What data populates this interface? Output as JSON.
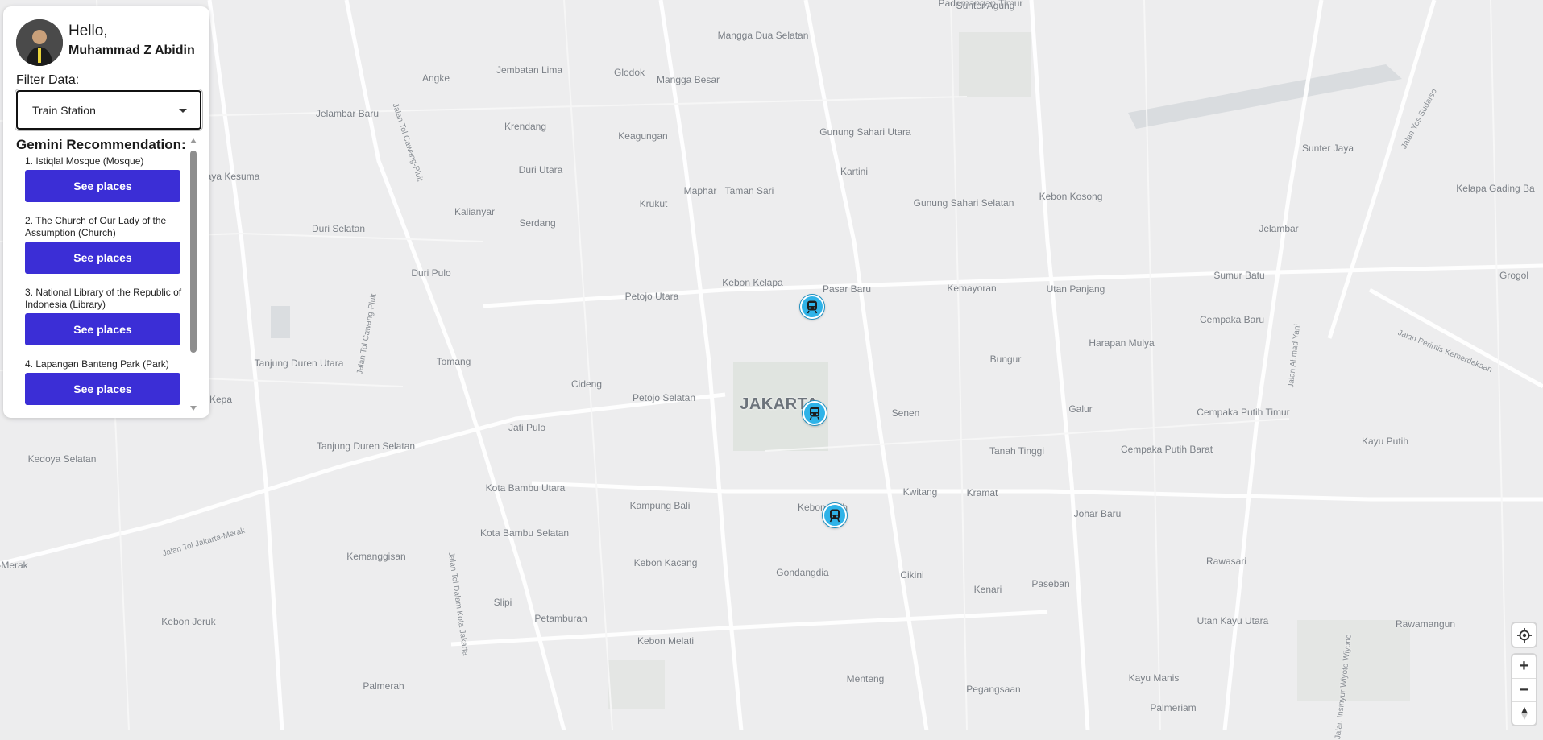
{
  "user": {
    "greeting": "Hello,",
    "name": "Muhammad Z Abidin"
  },
  "filter": {
    "label": "Filter Data:",
    "selected": "Train Station"
  },
  "recommendation": {
    "title": "Gemini Recommendation:",
    "items": [
      {
        "name": "1. Istiqlal Mosque (Mosque)",
        "button": "See places"
      },
      {
        "name": "2. The Church of Our Lady of the Assumption (Church)",
        "button": "See places"
      },
      {
        "name": "3. National Library of the Republic of Indonesia (Library)",
        "button": "See places"
      },
      {
        "name": "4. Lapangan Banteng Park (Park)",
        "button": "See places"
      }
    ]
  },
  "map": {
    "city": "JAKARTA",
    "labels": [
      "Pademangan Timur",
      "Sunter Agung",
      "Mangga Dua Selatan",
      "Angke",
      "Jembatan Lima",
      "Glodok",
      "Mangga Besar",
      "Jelambar Baru",
      "Krendang",
      "Keagungan",
      "Gunung Sahari Utara",
      "Sunter Jaya",
      "Kelapa Gading Ba",
      "aya Kesuma",
      "Duri Utara",
      "Kartini",
      "Maphar",
      "Taman Sari",
      "Krukut",
      "Kalianyar",
      "Gunung Sahari Selatan",
      "Kebon Kosong",
      "Jelambar",
      "Duri Selatan",
      "Serdang",
      "Grogol",
      "Duri Pulo",
      "Sumur Batu",
      "Petojo Utara",
      "Kebon Kelapa",
      "Pasar Baru",
      "Kemayoran",
      "Utan Panjang",
      "Cempaka Baru",
      "Harapan Mulya",
      "Tanjung Duren Utara",
      "Tomang",
      "Bungur",
      "Cideng",
      "Petojo Selatan",
      "Galur",
      "Cempaka Putih Timur",
      "Kepa",
      "Senen",
      "Jati Pulo",
      "Tanjung Duren Selatan",
      "Kayu Putih",
      "Tanah Tinggi",
      "Cempaka Putih Barat",
      "Kedoya Selatan",
      "Kota Bambu Utara",
      "Kwitang",
      "Kramat",
      "Johar Baru",
      "Kampung Bali",
      "Kebon Sirih",
      "Kota Bambu Selatan",
      "Kemanggisan",
      "-Merak",
      "Rawasari",
      "Kebon Kacang",
      "Gondangdia",
      "Cikini",
      "Kenari",
      "Paseban",
      "Rawamangun",
      "Slipi",
      "Petamburan",
      "Utan Kayu Utara",
      "Kebon Jeruk",
      "Kebon Melati",
      "Palmerah",
      "Menteng",
      "Pegangsaan",
      "Kayu Manis",
      "Palmeriam"
    ],
    "roads": [
      "Jalan Tol Cawang-Pluit",
      "Jalan Tol Jakarta-Merak",
      "Jalan Tol Dalam Kota Jakarta",
      "Jalan Tol Cawang-Pluit",
      "Jalan Yos Sudarso",
      "Jalan Ahmad Yani",
      "Jalan Perintis Kemerdekaan",
      "Jalan Insinyur Wiyoto Wiyono"
    ],
    "markers": [
      "train-station",
      "train-station",
      "train-station"
    ]
  },
  "controls": {
    "geolocate": "geolocate-icon",
    "zoom_in": "+",
    "zoom_out": "−",
    "compass": "compass-icon"
  }
}
